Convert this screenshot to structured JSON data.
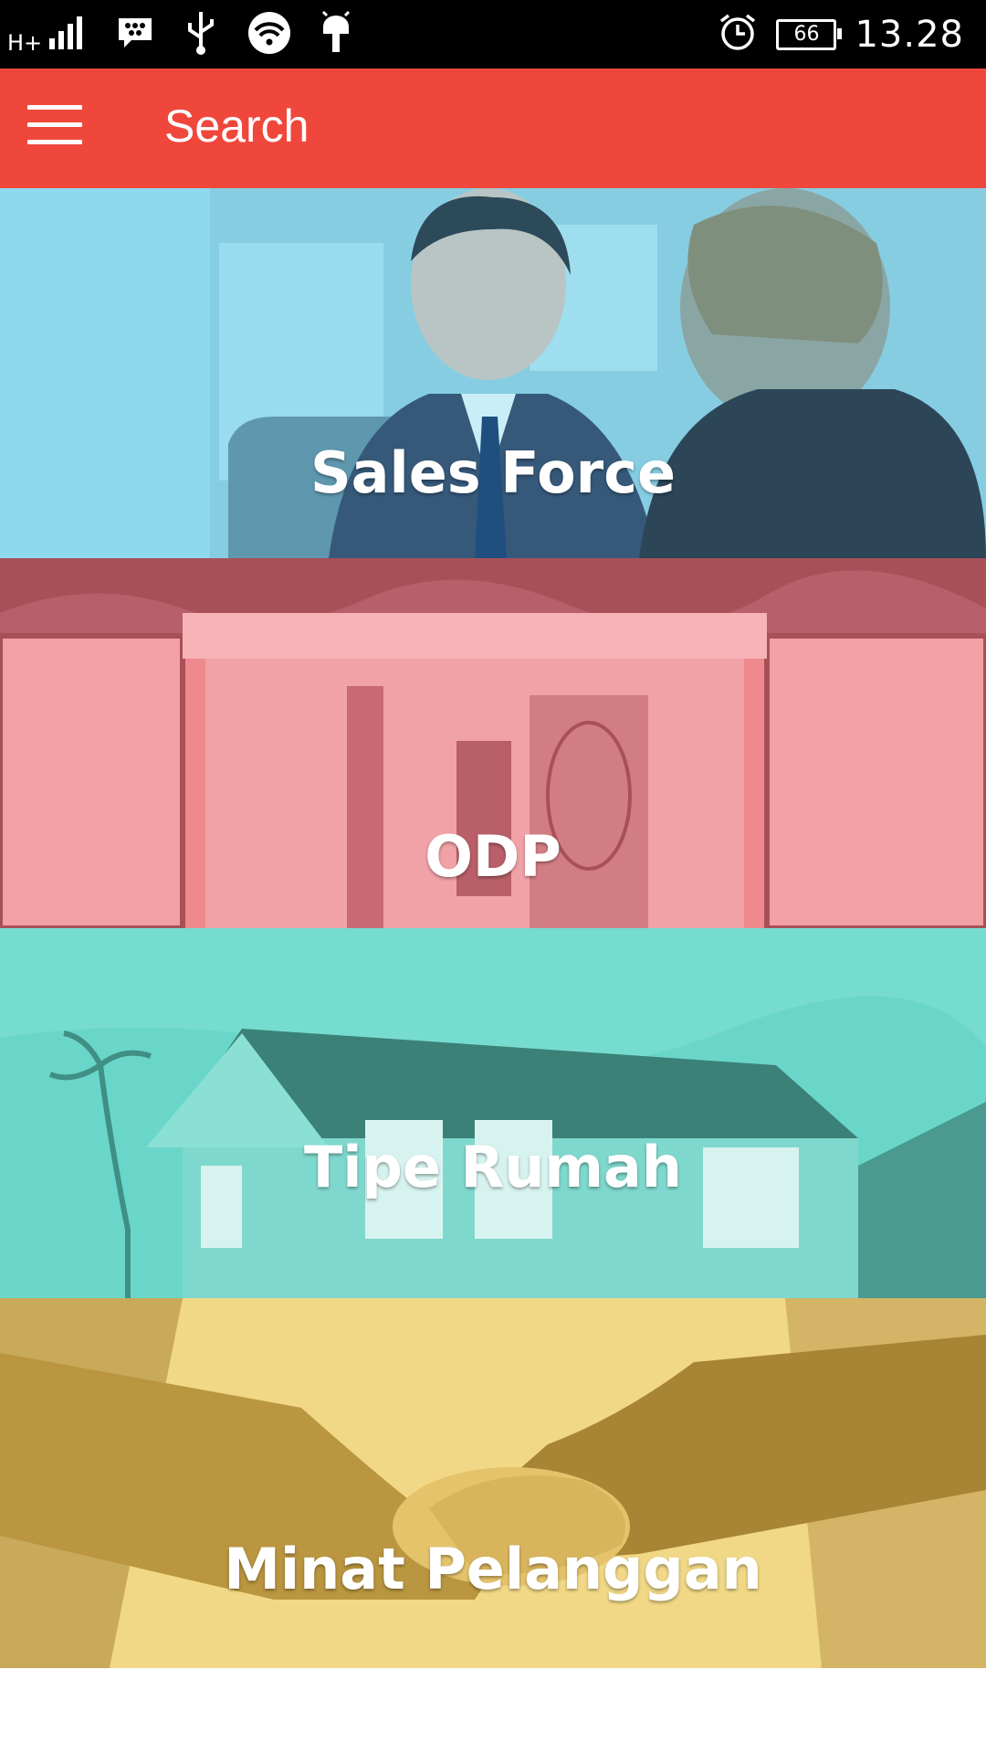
{
  "status_bar": {
    "network_label": "H+",
    "battery_level": "66",
    "time": "13.28",
    "icons": [
      "signal-icon",
      "bbm-icon",
      "usb-icon",
      "wifi-icon",
      "android-icon",
      "alarm-icon",
      "battery-icon"
    ]
  },
  "app_bar": {
    "title": "Search",
    "menu_icon": "hamburger-menu-icon",
    "background_color": "#f0473c"
  },
  "menu_tiles": [
    {
      "label": "Sales Force",
      "overlay_color": "#8fd9ef"
    },
    {
      "label": "ODP",
      "overlay_color": "#ee8a8e"
    },
    {
      "label": "Tipe Rumah",
      "overlay_color": "#5fd3c6"
    },
    {
      "label": "Minat Pelanggan",
      "overlay_color": "#efd27c"
    }
  ]
}
